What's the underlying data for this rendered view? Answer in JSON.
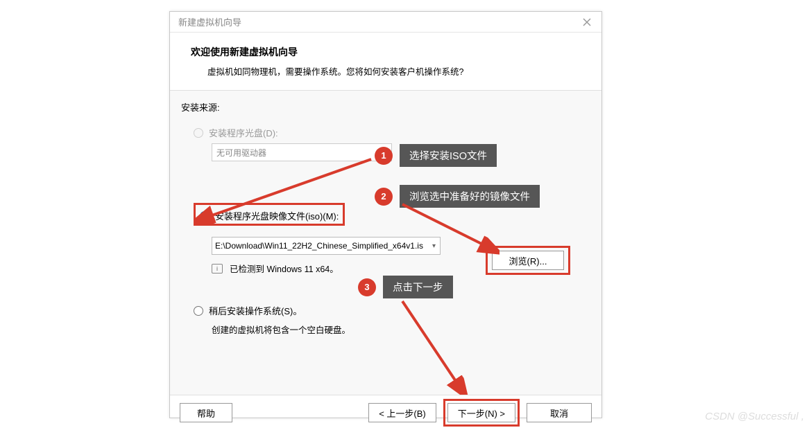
{
  "dialog": {
    "title": "新建虚拟机向导",
    "header_title": "欢迎使用新建虚拟机向导",
    "header_subtitle": "虚拟机如同物理机，需要操作系统。您将如何安装客户机操作系统?",
    "section_label": "安装来源:",
    "radio_disc": {
      "label": "安装程序光盘(D):",
      "dropdown_value": "无可用驱动器"
    },
    "radio_iso": {
      "label": "安装程序光盘映像文件(iso)(M):",
      "path": "E:\\Download\\Win11_22H2_Chinese_Simplified_x64v1.is",
      "browse": "浏览(R)..."
    },
    "detected_text": "已检测到 Windows 11 x64。",
    "radio_later": {
      "label": "稍后安装操作系统(S)。",
      "desc": "创建的虚拟机将包含一个空白硬盘。"
    }
  },
  "footer": {
    "help": "帮助",
    "back": "< 上一步(B)",
    "next": "下一步(N) >",
    "cancel": "取消"
  },
  "annotations": {
    "c1": "选择安装ISO文件",
    "c2": "浏览选中准备好的镜像文件",
    "c3": "点击下一步"
  },
  "watermark": "CSDN @Successful ,"
}
